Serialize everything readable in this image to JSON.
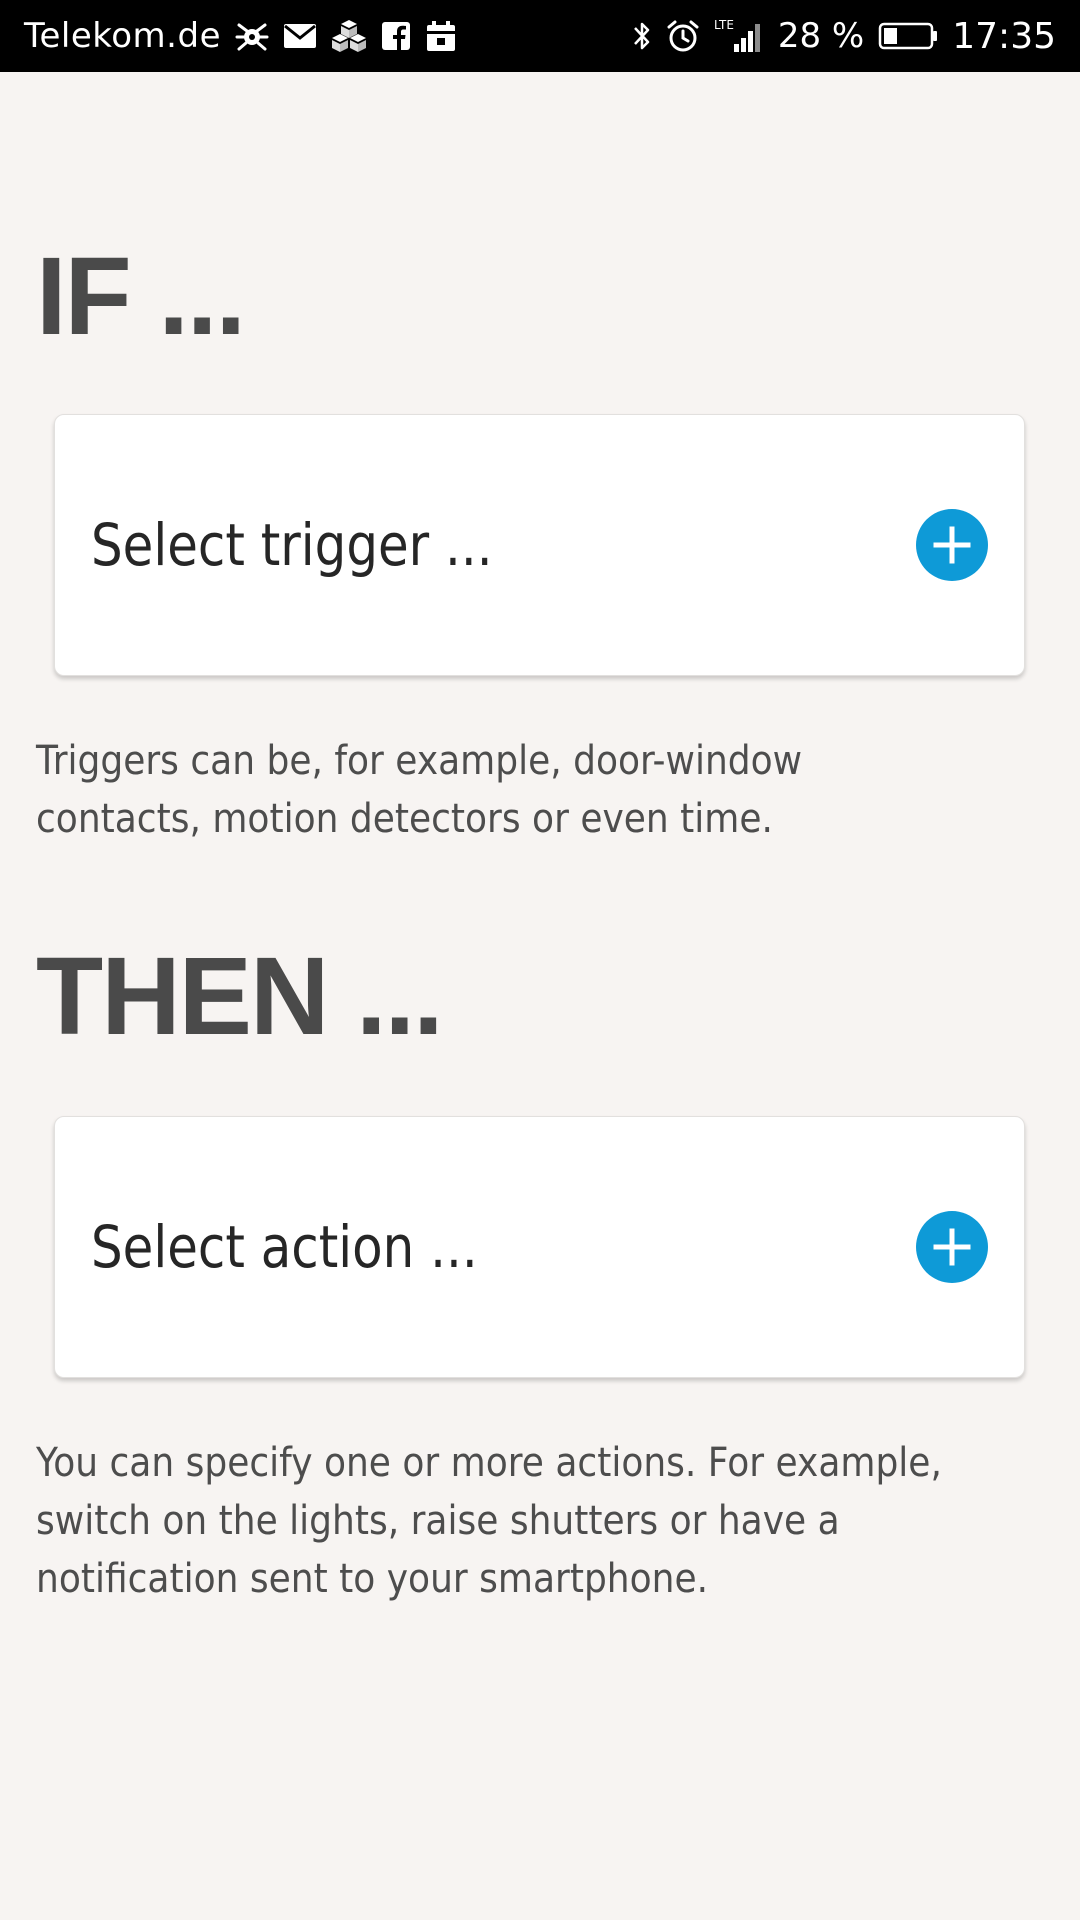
{
  "status_bar": {
    "carrier": "Telekom.de",
    "network": "LTE",
    "battery": "28 %",
    "time": "17:35",
    "left_icons": [
      "bug-icon",
      "mail-icon",
      "cubes-icon",
      "facebook-icon",
      "calendar-icon"
    ],
    "right_icons": [
      "bluetooth-icon",
      "alarm-icon",
      "signal-icon",
      "battery-icon"
    ]
  },
  "if_section": {
    "heading": "IF ...",
    "card_label": "Select trigger ...",
    "add_icon": "plus-circle-icon",
    "help_text": "Triggers can be, for example, door-window contacts, motion detectors or even time."
  },
  "then_section": {
    "heading": "THEN ...",
    "card_label": "Select action ...",
    "add_icon": "plus-circle-icon",
    "help_text": "You can specify one or more actions. For example, switch on the lights, raise shutters or have a notification sent to your smartphone."
  },
  "colors": {
    "background": "#f7f4f2",
    "accent": "#0e9ad7",
    "heading": "#4a4a4a",
    "text": "#262626",
    "status_bar": "#000000"
  }
}
